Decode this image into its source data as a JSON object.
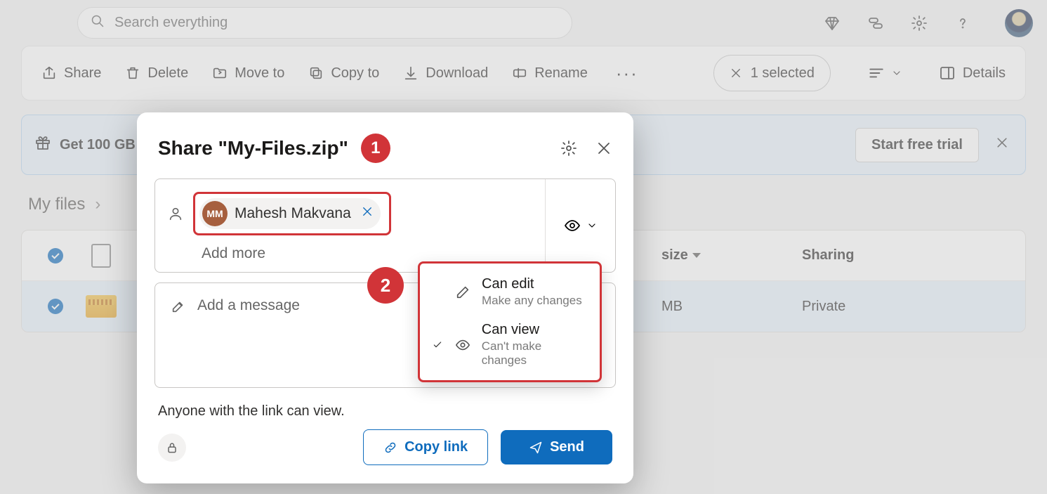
{
  "search": {
    "placeholder": "Search everything"
  },
  "toolbar": {
    "share": "Share",
    "delete": "Delete",
    "moveto": "Move to",
    "copyto": "Copy to",
    "download": "Download",
    "rename": "Rename",
    "selected": "1 selected",
    "details": "Details"
  },
  "promo": {
    "text": "Get 100 GB",
    "trial": "Start free trial"
  },
  "breadcrumb": {
    "root": "My files"
  },
  "columns": {
    "size": "size",
    "sharing": "Sharing"
  },
  "row": {
    "size": "MB",
    "sharing": "Private"
  },
  "modal": {
    "title": "Share \"My-Files.zip\"",
    "chip_initials": "MM",
    "chip_name": "Mahesh Makvana",
    "add_more": "Add more",
    "message_placeholder": "Add a message",
    "link_desc": "Anyone with the link can view.",
    "copy": "Copy link",
    "send": "Send"
  },
  "dropdown": {
    "edit_title": "Can edit",
    "edit_sub": "Make any changes",
    "view_title": "Can view",
    "view_sub": "Can't make changes"
  },
  "annotations": {
    "one": "1",
    "two": "2"
  }
}
